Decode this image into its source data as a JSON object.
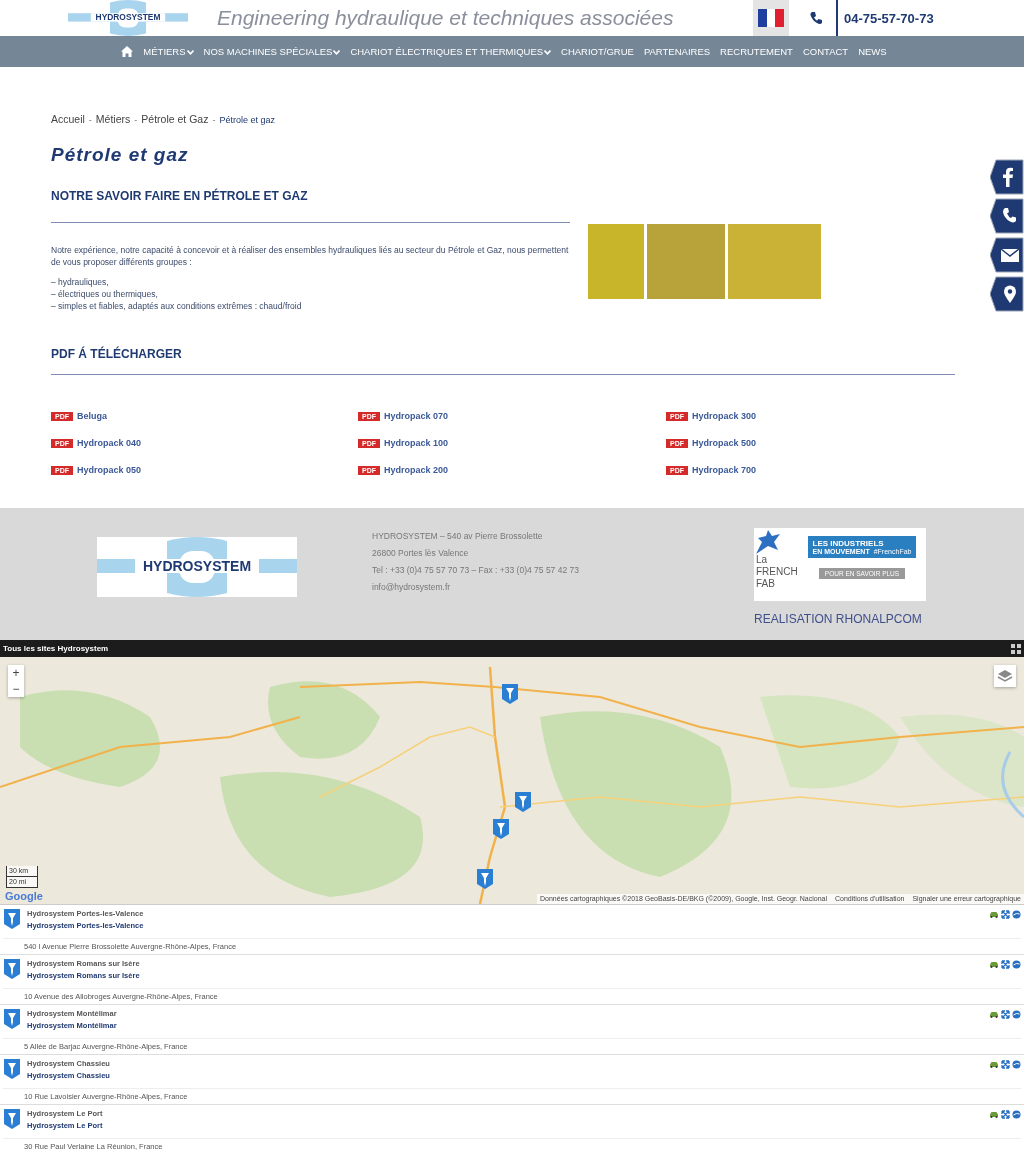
{
  "header": {
    "logo_text": "HYDROSYSTEM",
    "tagline": "Engineering hydraulique et techniques associées",
    "phone": "04-75-57-70-73"
  },
  "nav": [
    {
      "kind": "home",
      "dropdown": false
    },
    {
      "kind": "link",
      "label": "MÉTIERS",
      "dropdown": true
    },
    {
      "kind": "link",
      "label": "NOS MACHINES SPÉCIALES",
      "dropdown": true
    },
    {
      "kind": "link",
      "label": "CHARIOT ÉLECTRIQUES ET THERMIQUES",
      "dropdown": true
    },
    {
      "kind": "link",
      "label": "CHARIOT/GRUE",
      "dropdown": false
    },
    {
      "kind": "link",
      "label": "PARTENAIRES",
      "dropdown": false
    },
    {
      "kind": "link",
      "label": "RECRUTEMENT",
      "dropdown": false
    },
    {
      "kind": "link",
      "label": "CONTACT",
      "dropdown": false
    },
    {
      "kind": "link",
      "label": "NEWS",
      "dropdown": false
    }
  ],
  "breadcrumb": [
    {
      "label": "Accueil",
      "current": false
    },
    {
      "separator": "-",
      "label": "Métiers",
      "current": false
    },
    {
      "separator": "-",
      "label": "Pétrole et Gaz",
      "current": false
    },
    {
      "separator": "-",
      "label": "Pétrole et gaz",
      "current": true
    }
  ],
  "page_title": "Pétrole et gaz",
  "intro": {
    "heading": "NOTRE SAVOIR FAIRE EN PÉTROLE ET GAZ",
    "paragraph": "Notre expérience, notre capacité à concevoir et à réaliser des ensembles hydrauliques liés au secteur du Pétrole et Gaz, nous permettent de vous proposer différents groupes :",
    "bullets": [
      "– hydrauliques,",
      "– électriques ou thermiques,",
      "– simples et fiables, adaptés aux conditions extrêmes : chaud/froid"
    ]
  },
  "social": [
    {
      "kind": "facebook"
    },
    {
      "kind": "phone"
    },
    {
      "kind": "mail"
    },
    {
      "kind": "location"
    }
  ],
  "downloads": {
    "heading": "PDF Á TÉLÉCHARGER",
    "files": [
      {
        "label": "Beluga",
        "badge": "PDF"
      },
      {
        "label": "Hydropack 070",
        "badge": "PDF"
      },
      {
        "label": "Hydropack 300",
        "badge": "PDF"
      },
      {
        "label": "Hydropack 040",
        "badge": "PDF"
      },
      {
        "label": "Hydropack 100",
        "badge": "PDF"
      },
      {
        "label": "Hydropack 500",
        "badge": "PDF"
      },
      {
        "label": "Hydropack 050",
        "badge": "PDF"
      },
      {
        "label": "Hydropack 200",
        "badge": "PDF"
      },
      {
        "label": "Hydropack 700",
        "badge": "PDF"
      }
    ]
  },
  "footer": {
    "logo_text": "HYDROSYSTEM",
    "address": [
      "HYDROSYSTEM – 540 av Pierre Brossolette",
      "26800 Portes lès Valence",
      "Tel : +33 (0)4 75 57 70 73 – Fax : +33 (0)4 75 57 42 73",
      "info@hydrosystem.fr"
    ],
    "badge": {
      "brand": [
        "La",
        "FRENCH",
        "FAB"
      ],
      "title": "LES INDUSTRIELS",
      "subtitle": "EN MOUVEMENT",
      "tag": "#FrenchFab",
      "cta": "POUR EN SAVOIR PLUS"
    },
    "credit": "REALISATION RHONALPCOM"
  },
  "map": {
    "title": "Tous les sites Hydrosystem",
    "zoom_in": "+",
    "zoom_out": "−",
    "scale": [
      "30 km",
      "20 mi"
    ],
    "logo": "Google",
    "attribution": [
      "Données cartographiques ©2018 GeoBasis-DE/BKG (©2009), Google, Inst. Geogr. Nacional",
      "Conditions d'utilisation",
      "Signaler une erreur cartographique"
    ]
  },
  "locations": [
    {
      "title": "Hydrosystem Portes-les-Valence",
      "link": "Hydrosystem Portes-les-Valence",
      "address": "540 l Avenue Pierre Brossolette Auvergne-Rhône-Alpes, France"
    },
    {
      "title": "Hydrosystem Romans sur Isère",
      "link": "Hydrosystem Romans sur Isère",
      "address": "10 Avenue des Allobroges Auvergne-Rhône-Alpes, France"
    },
    {
      "title": "Hydrosystem Montélimar",
      "link": "Hydrosystem Montélimar",
      "address": "5 Allée de Barjac Auvergne-Rhône-Alpes, France"
    },
    {
      "title": "Hydrosystem Chassieu",
      "link": "Hydrosystem Chassieu",
      "address": "10 Rue Lavoisier Auvergne-Rhône-Alpes, France"
    },
    {
      "title": "Hydrosystem Le Port",
      "link": "Hydrosystem Le Port",
      "address": "30 Rue Paul Verlaine La Réunion, France"
    }
  ]
}
